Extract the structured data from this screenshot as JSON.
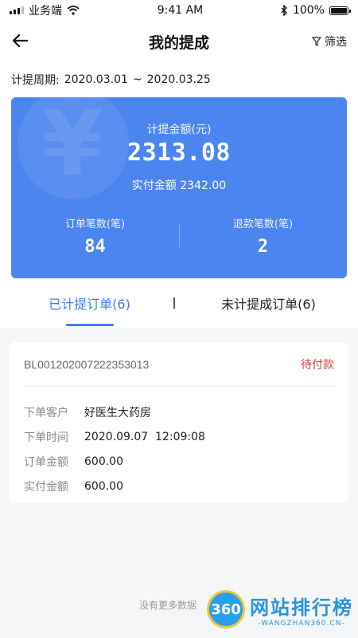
{
  "statusbar": {
    "carrier": "业务端",
    "time": "9:41 AM",
    "battery": "100%"
  },
  "nav": {
    "title": "我的提成",
    "filter_label": "筛选"
  },
  "period": {
    "label": "计提周期:",
    "start": "2020.03.01",
    "sep": "~",
    "end": "2020.03.25"
  },
  "summary": {
    "amount_label": "计提金额(元)",
    "amount_value": "2313.08",
    "paid_label": "实付金额",
    "paid_value": "2342.00",
    "order_count_label": "订单笔数(笔)",
    "order_count_value": "84",
    "refund_count_label": "退款笔数(笔)",
    "refund_count_value": "2"
  },
  "tabs": [
    {
      "label": "已计提订单(6)",
      "active": true
    },
    {
      "label": "未计提成订单(6)",
      "active": false
    }
  ],
  "order": {
    "id": "BL001202007222353013",
    "status": "待付款",
    "rows": [
      {
        "key": "下单客户",
        "value": "好医生大药房"
      },
      {
        "key": "下单时间",
        "value": "2020.09.07  12:09:08"
      },
      {
        "key": "订单金额",
        "value": "600.00"
      },
      {
        "key": "实付金额",
        "value": "600.00"
      }
    ]
  },
  "footer": {
    "note": "没有更多数据"
  },
  "watermark": {
    "badge": "360",
    "cn": "网站排行榜",
    "en": "-WANGZHAN360.CN-"
  },
  "colors": {
    "primary": "#4d85f0",
    "tab_active": "#3d7cf0",
    "status": "#e5383b"
  }
}
